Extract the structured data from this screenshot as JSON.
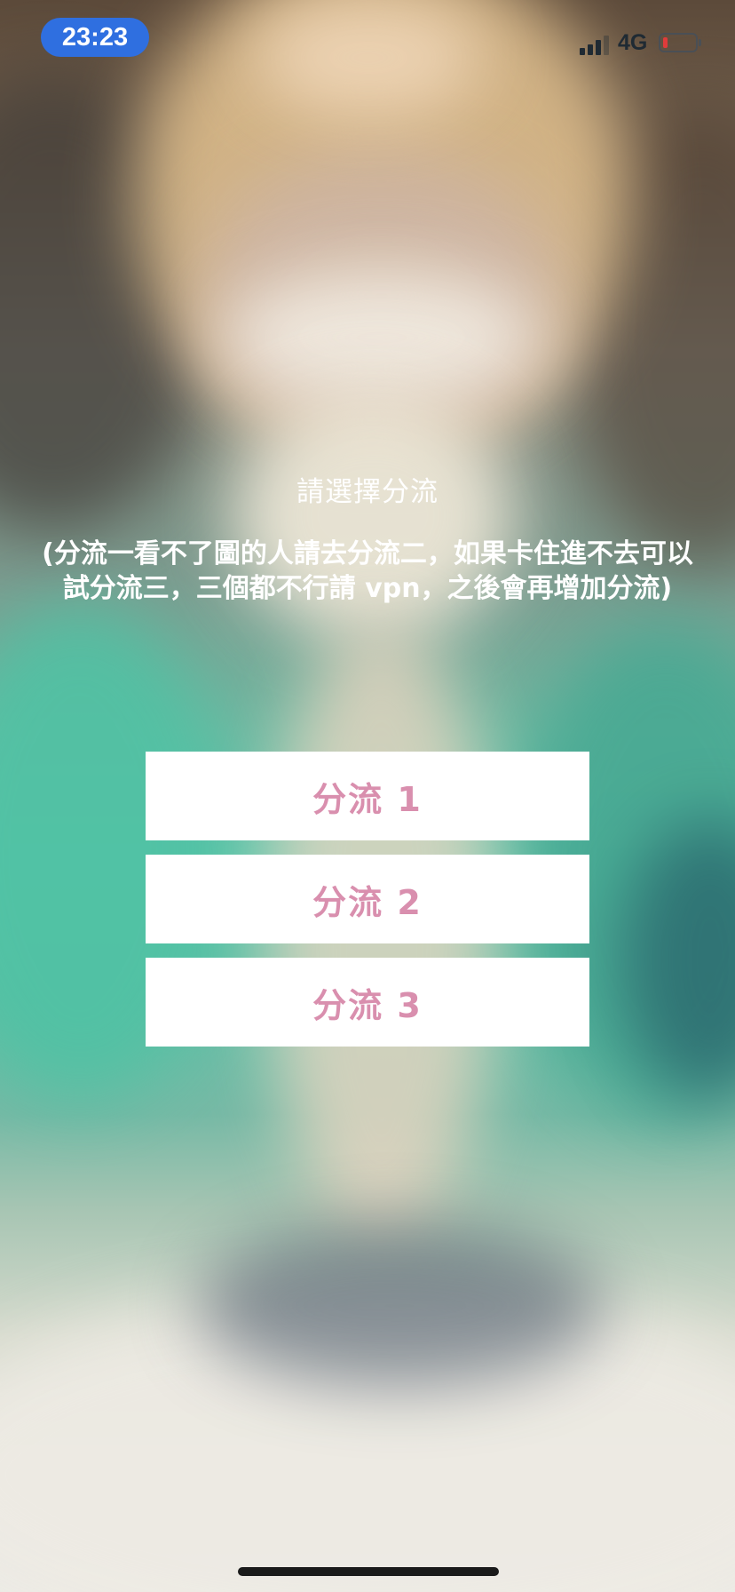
{
  "status_bar": {
    "time": "23:23",
    "network": "4G",
    "battery_level": 0.15,
    "battery_color": "#e03b3b",
    "signal_bars": 3
  },
  "page": {
    "title": "請選擇分流",
    "notice": "(分流一看不了圖的人請去分流二，如果卡住進不去可以試分流三，三個都不行請 vpn，之後會再增加分流)"
  },
  "routes": [
    {
      "label": "分流 1"
    },
    {
      "label": "分流 2"
    },
    {
      "label": "分流 3"
    }
  ],
  "colors": {
    "button_text": "#d98fae",
    "button_bg": "#ffffff",
    "time_pill": "#2f6fe0"
  }
}
